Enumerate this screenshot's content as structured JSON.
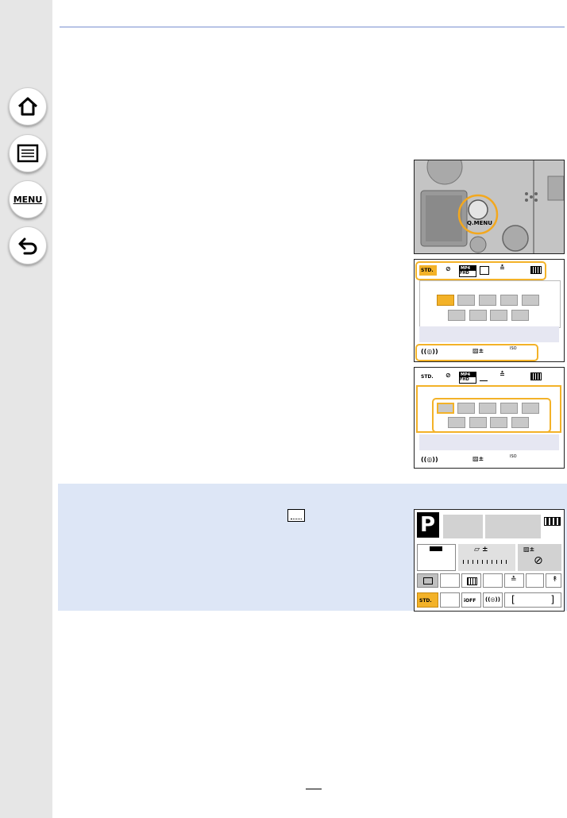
{
  "sidebar": {
    "home_icon": "home-icon",
    "contents_icon": "list-icon",
    "menu_label": "MENU",
    "back_icon": "back-arrow-icon"
  },
  "camera": {
    "qmenu_label": "Q.MENU"
  },
  "screen1": {
    "std_label": "STD.",
    "mp4_label": "MP4",
    "fhd_label": "FHD"
  },
  "screen2": {
    "std_label": "STD.",
    "mp4_label": "MP4",
    "fhd_label": "FHD"
  },
  "info_screen": {
    "mode_label": "P",
    "std_label": "STD.",
    "ioff_label": "iOFF"
  },
  "colors": {
    "accent": "#f3b228",
    "info_bg": "#dde6f6",
    "sidebar_bg": "#e6e6e6"
  }
}
